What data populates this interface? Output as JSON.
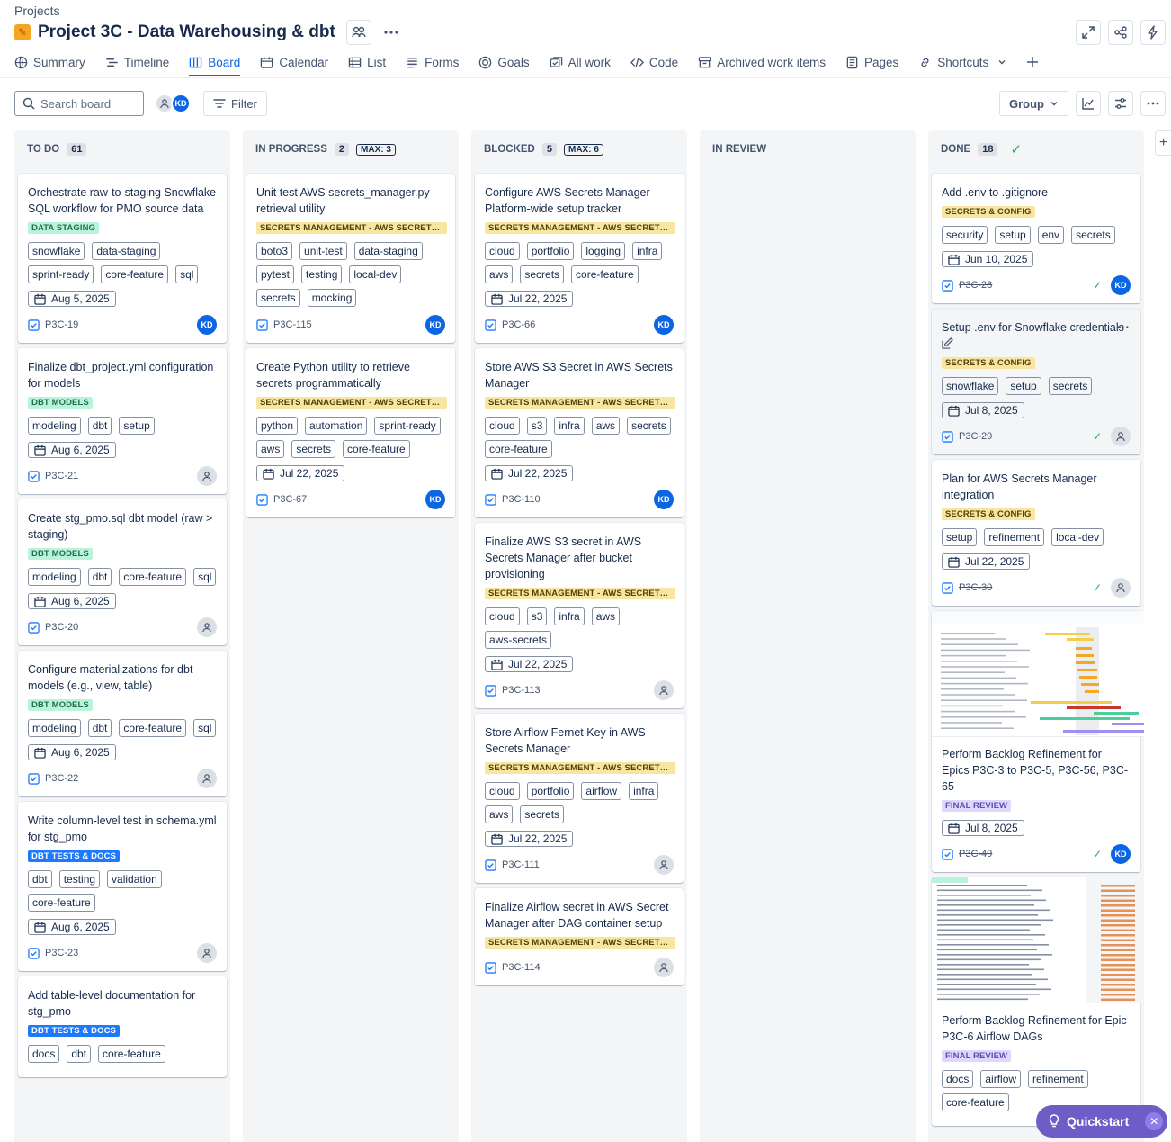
{
  "breadcrumb": "Projects",
  "project": {
    "title": "Project 3C - Data Warehousing & dbt"
  },
  "nav": {
    "tabs": [
      {
        "label": "Summary",
        "icon": "globe-icon"
      },
      {
        "label": "Timeline",
        "icon": "timeline-icon"
      },
      {
        "label": "Board",
        "icon": "board-icon",
        "active": true
      },
      {
        "label": "Calendar",
        "icon": "calendar-icon"
      },
      {
        "label": "List",
        "icon": "list-icon"
      },
      {
        "label": "Forms",
        "icon": "forms-icon"
      },
      {
        "label": "Goals",
        "icon": "goals-icon"
      },
      {
        "label": "All work",
        "icon": "all-work-icon"
      },
      {
        "label": "Code",
        "icon": "code-icon"
      },
      {
        "label": "Archived work items",
        "icon": "archive-icon"
      },
      {
        "label": "Pages",
        "icon": "pages-icon"
      },
      {
        "label": "Shortcuts",
        "icon": "link-icon"
      }
    ]
  },
  "toolbar": {
    "search_placeholder": "Search board",
    "avatar_initials": "KD",
    "filter_label": "Filter",
    "group_label": "Group"
  },
  "columns": [
    {
      "name": "TO DO",
      "count": "61",
      "max": "",
      "cards": [
        {
          "title": "Orchestrate raw-to-staging Snowflake SQL workflow for PMO source data",
          "epic": "DATA STAGING",
          "epic_color": "green",
          "labels": [
            "snowflake",
            "data-staging",
            "sprint-ready",
            "core-feature",
            "sql"
          ],
          "date": "Aug 5, 2025",
          "key": "P3C-19",
          "assignee": "KD"
        },
        {
          "title": "Finalize dbt_project.yml configuration for models",
          "epic": "DBT MODELS",
          "epic_color": "green",
          "labels": [
            "modeling",
            "dbt",
            "setup"
          ],
          "date": "Aug 6, 2025",
          "key": "P3C-21",
          "assignee": ""
        },
        {
          "title": "Create stg_pmo.sql dbt model (raw > staging)",
          "epic": "DBT MODELS",
          "epic_color": "green",
          "labels": [
            "modeling",
            "dbt",
            "core-feature",
            "sql"
          ],
          "date": "Aug 6, 2025",
          "key": "P3C-20",
          "assignee": ""
        },
        {
          "title": "Configure materializations for dbt models (e.g., view, table)",
          "epic": "DBT MODELS",
          "epic_color": "green",
          "labels": [
            "modeling",
            "dbt",
            "core-feature",
            "sql"
          ],
          "date": "Aug 6, 2025",
          "key": "P3C-22",
          "assignee": ""
        },
        {
          "title": "Write column-level test in schema.yml for stg_pmo",
          "epic": "DBT TESTS & DOCS",
          "epic_color": "blue",
          "labels": [
            "dbt",
            "testing",
            "validation",
            "core-feature"
          ],
          "date": "Aug 6, 2025",
          "key": "P3C-23",
          "assignee": ""
        },
        {
          "title": "Add table-level documentation for stg_pmo",
          "epic": "DBT TESTS & DOCS",
          "epic_color": "blue",
          "labels": [
            "docs",
            "dbt",
            "core-feature"
          ],
          "date": "",
          "key": "",
          "assignee": ""
        }
      ]
    },
    {
      "name": "IN PROGRESS",
      "count": "2",
      "max": "MAX: 3",
      "cards": [
        {
          "title": "Unit test AWS secrets_manager.py retrieval utility",
          "epic": "SECRETS MANAGEMENT - AWS SECRETS...",
          "epic_color": "yellow",
          "labels": [
            "boto3",
            "unit-test",
            "data-staging",
            "pytest",
            "testing",
            "local-dev",
            "secrets",
            "mocking"
          ],
          "date": "",
          "key": "P3C-115",
          "assignee": "KD"
        },
        {
          "title": "Create Python utility to retrieve secrets programmatically",
          "epic": "SECRETS MANAGEMENT - AWS SECRETS...",
          "epic_color": "yellow",
          "labels": [
            "python",
            "automation",
            "sprint-ready",
            "aws",
            "secrets",
            "core-feature"
          ],
          "date": "Jul 22, 2025",
          "key": "P3C-67",
          "assignee": "KD"
        }
      ]
    },
    {
      "name": "BLOCKED",
      "count": "5",
      "max": "MAX: 6",
      "cards": [
        {
          "title": "Configure AWS Secrets Manager - Platform-wide setup tracker",
          "epic": "SECRETS MANAGEMENT - AWS SECRETS...",
          "epic_color": "yellow",
          "labels": [
            "cloud",
            "portfolio",
            "logging",
            "infra",
            "aws",
            "secrets",
            "core-feature"
          ],
          "date": "Jul 22, 2025",
          "key": "P3C-66",
          "assignee": "KD"
        },
        {
          "title": "Store AWS S3 Secret in AWS Secrets Manager",
          "epic": "SECRETS MANAGEMENT - AWS SECRETS...",
          "epic_color": "yellow",
          "labels": [
            "cloud",
            "s3",
            "infra",
            "aws",
            "secrets",
            "core-feature"
          ],
          "date": "Jul 22, 2025",
          "key": "P3C-110",
          "assignee": "KD"
        },
        {
          "title": "Finalize AWS S3 secret in AWS Secrets Manager after bucket provisioning",
          "epic": "SECRETS MANAGEMENT - AWS SECRETS...",
          "epic_color": "yellow",
          "labels": [
            "cloud",
            "s3",
            "infra",
            "aws",
            "aws-secrets"
          ],
          "date": "Jul 22, 2025",
          "key": "P3C-113",
          "assignee": ""
        },
        {
          "title": "Store Airflow Fernet Key in AWS Secrets Manager",
          "epic": "SECRETS MANAGEMENT - AWS SECRETS...",
          "epic_color": "yellow",
          "labels": [
            "cloud",
            "portfolio",
            "airflow",
            "infra",
            "aws",
            "secrets"
          ],
          "date": "Jul 22, 2025",
          "key": "P3C-111",
          "assignee": ""
        },
        {
          "title": "Finalize Airflow secret in AWS Secret Manager after DAG container setup",
          "epic": "SECRETS MANAGEMENT - AWS SECRETS...",
          "epic_color": "yellow",
          "labels": [],
          "date": "",
          "key": "P3C-114",
          "assignee": ""
        }
      ]
    },
    {
      "name": "IN REVIEW",
      "count": "",
      "max": "",
      "cards": []
    },
    {
      "name": "DONE",
      "count": "18",
      "max": "",
      "cards": [
        {
          "title": "Add .env to .gitignore",
          "epic": "SECRETS & CONFIG",
          "epic_color": "yellow",
          "labels": [
            "security",
            "setup",
            "env",
            "secrets"
          ],
          "date": "Jun 10, 2025",
          "key": "P3C-28",
          "assignee": "KD",
          "done": true
        },
        {
          "title": "Setup .env for Snowflake credentials",
          "epic": "SECRETS & CONFIG",
          "epic_color": "yellow",
          "labels": [
            "snowflake",
            "setup",
            "secrets"
          ],
          "date": "Jul 8, 2025",
          "key": "P3C-29",
          "assignee": "",
          "done": true,
          "hover": true
        },
        {
          "title": "Plan for AWS Secrets Manager integration",
          "epic": "SECRETS & CONFIG",
          "epic_color": "yellow",
          "labels": [
            "setup",
            "refinement",
            "local-dev"
          ],
          "date": "Jul 22, 2025",
          "key": "P3C-30",
          "assignee": "",
          "done": true
        },
        {
          "title": "Perform Backlog Refinement for Epics P3C-3 to P3C-5, P3C-56, P3C-65",
          "epic": "FINAL REVIEW",
          "epic_color": "purple",
          "labels": [],
          "date": "Jul 8, 2025",
          "key": "P3C-49",
          "assignee": "KD",
          "done": true,
          "thumb": "gantt"
        },
        {
          "title": "Perform Backlog Refinement for Epic P3C-6 Airflow DAGs",
          "epic": "FINAL REVIEW",
          "epic_color": "purple",
          "labels": [
            "docs",
            "airflow",
            "refinement",
            "core-feature"
          ],
          "date": "",
          "key": "",
          "assignee": "",
          "done": true,
          "thumb": "list"
        }
      ]
    }
  ],
  "quickstart": {
    "label": "Quickstart"
  }
}
